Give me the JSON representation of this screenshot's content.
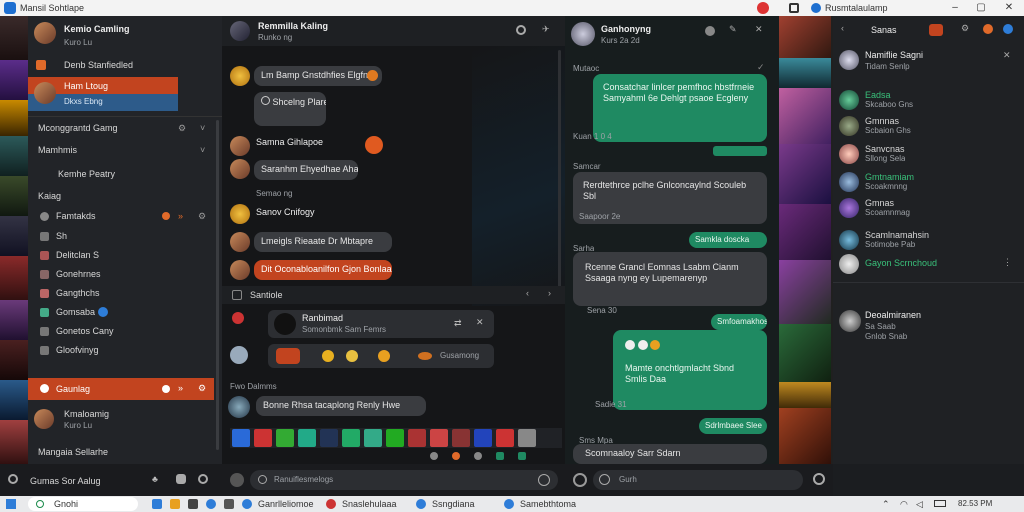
{
  "window": {
    "title": "Mansil Sohtlape",
    "tab_label": "Rusmtalaulamp"
  },
  "left_panel": {
    "header_name": "Kemio Camling",
    "header_sub": "Kuro Lu",
    "items": [
      {
        "label": "Denb Stanfiedled"
      },
      {
        "label": "Ham Ltoug",
        "sub": "Dkxs Ebng"
      },
      {
        "label": "Mconggrantd Gamg"
      },
      {
        "label": "Mamhmis"
      },
      {
        "label": "Kemhe Peatry"
      },
      {
        "label": "Kaiag"
      }
    ],
    "sub_items": [
      {
        "label": "Famtakds",
        "badge": "»"
      },
      {
        "label": "Sh"
      },
      {
        "label": "Delitclan S"
      },
      {
        "label": "Gonehrnes"
      },
      {
        "label": "Gangthchs"
      },
      {
        "label": "Gomsaba"
      },
      {
        "label": "Gonetos Cany"
      },
      {
        "label": "Gloofvinyg"
      }
    ],
    "active_item": "Gaunlag",
    "active_badge": "»",
    "bottom_name": "Kmaloamig",
    "bottom_sub": "Kuro Lu",
    "last_item": "Mangaia Sellarhe",
    "footer_label": "Gumas Sor Aalug"
  },
  "chat_middle": {
    "header_name": "Remmilla Kaling",
    "header_sub": "Runko ng",
    "messages": [
      {
        "text": "Lm Bamp Gnstdhfies Elgfna"
      },
      {
        "text": "Shcelng Plare Ia"
      },
      {
        "name": "Samna Gihlapoe",
        "text": "Saranhm Ehyedhae Ahaa"
      },
      {
        "name": "Semao ng",
        "text": ""
      },
      {
        "name": "Sanov Cnifogy",
        "text": "Lmeigls Rieaate Dr Mbtapre"
      },
      {
        "text": "Dit Oconabloanilfon Gjon Bonlaa"
      }
    ],
    "reply_label": "Santiole",
    "card_title": "Ranbimad",
    "card_sub": "Somonbmk Sam Femrs",
    "reaction_text": "Gusamong",
    "reply_author": "Fwo Dalmms",
    "reply_text": "Bonne Rhsa tacaplong Renly Hwe",
    "input_placeholder": "Ranuiflesmelogs"
  },
  "chat_right": {
    "header_name": "Ganhonyng",
    "header_sub": "Kurs 2a 2d",
    "status_label": "Mutaoc",
    "messages": [
      {
        "side": "out",
        "text": "Consatchar linlcer pemfhoc hbstfrneie Samyahml 6e Dehlgt psaoe Ecgleny",
        "time": "Kuan 1 0 4"
      },
      {
        "side": "in",
        "name": "Samcar",
        "text": "Rerdtethrce pclhe Gnlconcaylnd Scouleb Sbl",
        "time": "Saapoor 2e"
      },
      {
        "side": "out",
        "text": "Samkla doscka",
        "time": ""
      },
      {
        "side": "in",
        "name": "Sarha",
        "text": "Rcenne Grancl Eomnas Lsabm Cianm Ssaaga nyng ey Lupemarenyp",
        "time": "Sena 30"
      },
      {
        "side": "out",
        "text": "Smfoamakhos",
        "time": ""
      },
      {
        "side": "out",
        "text": "Mamte onchtlgmlacht Sbnd Smlis Daa",
        "time": "Sadie 31"
      },
      {
        "side": "out",
        "text": "Sdrlmbaee Slee",
        "time": ""
      },
      {
        "side": "in",
        "name": "Sms Mpa",
        "text": "Scomnaaloy Sarr Sdarn",
        "time": ""
      }
    ],
    "input_placeholder": "Gurh"
  },
  "contacts": {
    "header": "Sanas",
    "items": [
      {
        "name": "Namiflie Sagni",
        "sub": "Tidam Senlp"
      },
      {
        "name": "Eadsa",
        "sub": "Skcaboo Gns"
      },
      {
        "name": "Gmnnas",
        "sub": "Scbaion Ghs"
      },
      {
        "name": "Sanvcnas",
        "sub": "Sllong Sela"
      },
      {
        "name": "Gmtnamiam",
        "sub": "Scoakmnng"
      },
      {
        "name": "Gmnas",
        "sub": "Scoamnmag"
      },
      {
        "name": "Scamlnamahsin",
        "sub": "Sotimobe Pab"
      },
      {
        "name": "Gayon Scrnchoud",
        "sub": ""
      }
    ],
    "detail_name": "Deoalmiranen",
    "detail_sub1": "Sa Saab",
    "detail_sub2": "Gnlob Snab"
  },
  "taskbar": {
    "search_text": "Gnohi",
    "apps": [
      "Ganrlleliomoe",
      "Snaslehulaaa",
      "Ssngdiana",
      "Samebthtoma"
    ],
    "time": "82.53 PM"
  },
  "colors": {
    "accent_orange": "#c2441f",
    "accent_green": "#1f8a62",
    "bg": "#1b1d20"
  }
}
